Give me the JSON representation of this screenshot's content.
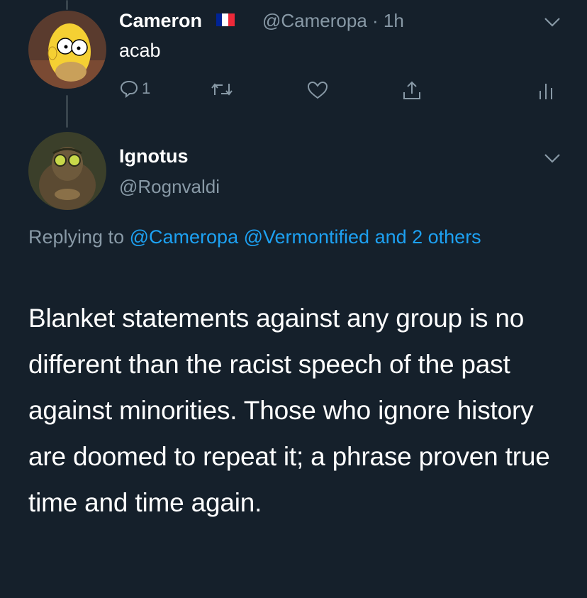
{
  "colors": {
    "background": "#15202b",
    "secondary_text": "#8899a6",
    "link": "#1da1f2",
    "thread_line": "#38444d",
    "flag": [
      "#002395",
      "#ffffff",
      "#ed2939"
    ]
  },
  "parent_tweet": {
    "display_name": "Cameron",
    "flag_icon": "france-flag-icon",
    "handle_time": "@Cameropa · 1h",
    "text": "acab",
    "reply_count": "1",
    "menu_icon": "chevron-down-icon",
    "actions": [
      "reply-icon",
      "retweet-icon",
      "like-icon",
      "share-icon",
      "analytics-icon"
    ]
  },
  "main_tweet": {
    "display_name": "Ignotus",
    "handle": "@Rognvaldi",
    "menu_icon": "chevron-down-icon",
    "replying_prefix": "Replying to",
    "replying_mentions": "@Cameropa @Vermontified and 2 others",
    "body": "Blanket statements against any group is no different than the racist speech of the past against minorities. Those who ignore history are doomed to repeat it; a phrase proven true time and time again."
  }
}
